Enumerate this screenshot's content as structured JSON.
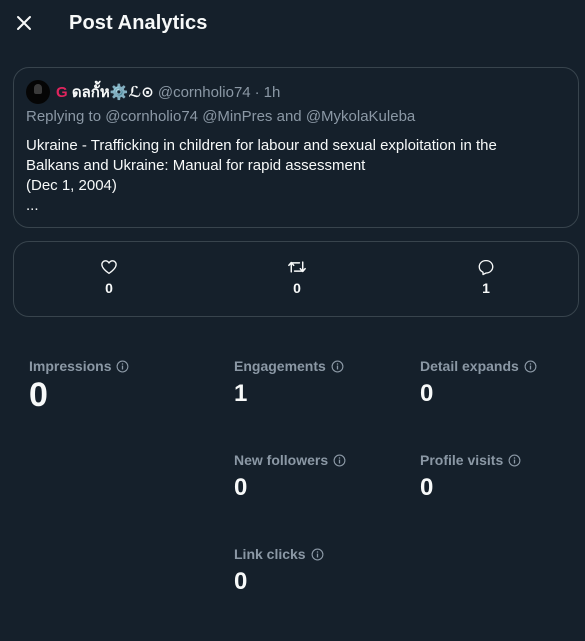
{
  "header": {
    "title": "Post Analytics"
  },
  "post": {
    "display_name_icon": "G",
    "display_name": "ดลกั้ห⚙️ℒ⊙",
    "handle": "@cornholio74",
    "separator": "·",
    "time": "1h",
    "reply_prefix": "Replying to",
    "mentions": [
      "@cornholio74",
      "@MinPres",
      "@MykolaKuleba"
    ],
    "mentions_and": "and",
    "text_lines": [
      "Ukraine - Trafficking in children for labour and sexual exploitation in the",
      "Balkans and Ukraine: Manual for rapid assessment",
      "(Dec 1, 2004)",
      "..."
    ]
  },
  "engagement_stats": [
    {
      "icon": "heart-icon",
      "count": "0"
    },
    {
      "icon": "retweet-icon",
      "count": "0"
    },
    {
      "icon": "reply-icon",
      "count": "1"
    }
  ],
  "metrics": {
    "impressions": {
      "label": "Impressions",
      "value": "0"
    },
    "engagements": {
      "label": "Engagements",
      "value": "1"
    },
    "detail_expands": {
      "label": "Detail expands",
      "value": "0"
    },
    "new_followers": {
      "label": "New followers",
      "value": "0"
    },
    "profile_visits": {
      "label": "Profile visits",
      "value": "0"
    },
    "link_clicks": {
      "label": "Link clicks",
      "value": "0"
    }
  },
  "colors": {
    "background": "#15202b",
    "border": "#38444d",
    "text_primary": "#f7f9f9",
    "text_secondary": "#8b98a5",
    "name_accent": "#e0245e"
  }
}
